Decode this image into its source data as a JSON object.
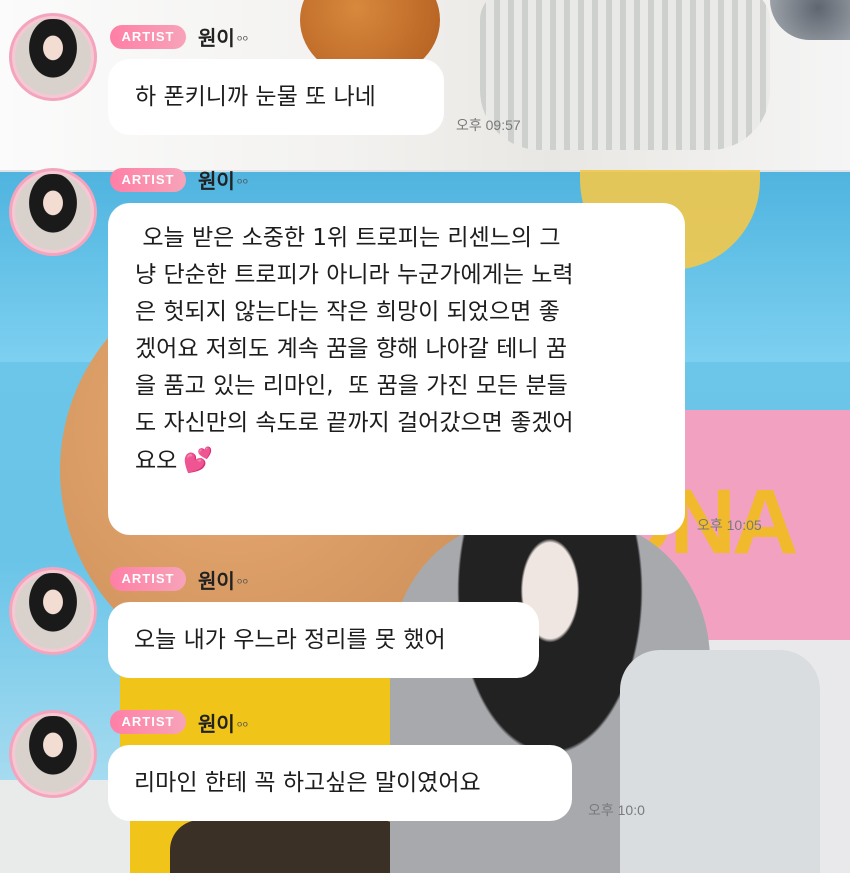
{
  "messages": [
    {
      "badge": "ARTIST",
      "sender": "원이",
      "sender_suffix": "ᵒᵒ",
      "text": "하 폰키니까 눈물 또 나네",
      "time": "오후 09:57"
    },
    {
      "badge": "ARTIST",
      "sender": "원이",
      "sender_suffix": "ᵒᵒ",
      "text": " 오늘 받은 소중한 1위 트로피는 리센느의 그\n냥 단순한 트로피가 아니라 누군가에게는 노력\n은 헛되지 않는다는 작은 희망이 되었으면 좋\n겠어요 저희도 계속 꿈을 향해 나아갈 테니 꿈\n을 품고 있는 리마인,  또 꿈을 가진 모든 분들\n도 자신만의 속도로 끝까지 걸어갔으면 좋겠어\n요오",
      "emoji": "💕",
      "time": "오후 10:05"
    },
    {
      "badge": "ARTIST",
      "sender": "원이",
      "sender_suffix": "ᵒᵒ",
      "text": "오늘 내가 우느라 정리를 못 했어",
      "time": ""
    },
    {
      "badge": "ARTIST",
      "sender": "원이",
      "sender_suffix": "ᵒᵒ",
      "text": "리마인 한테 꼭 하고싶은 말이였어요",
      "time": "오후 10:0"
    }
  ],
  "background_sign_text": "ONA",
  "colors": {
    "badge": "#ff7fa6",
    "bubble": "#ffffff",
    "avatar_ring": "#f3a5bd"
  }
}
